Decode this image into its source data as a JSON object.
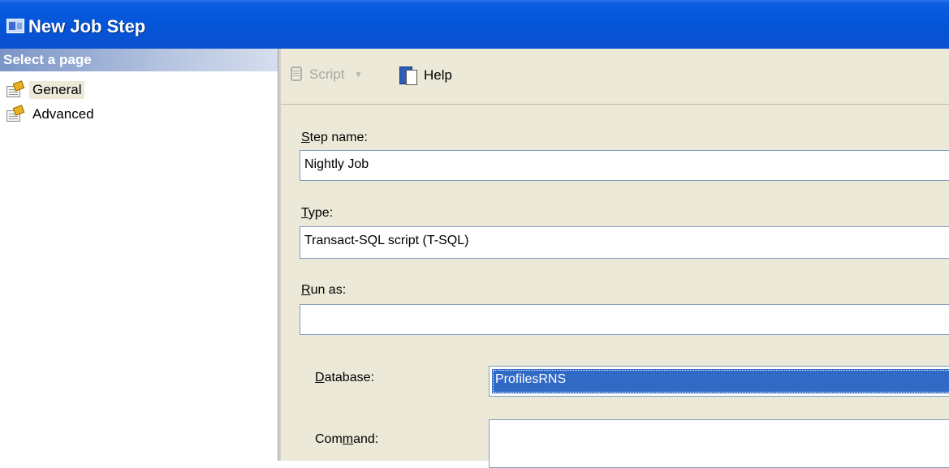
{
  "window": {
    "title": "New Job Step"
  },
  "left_pane": {
    "header": "Select a page",
    "items": [
      {
        "label": "General",
        "selected": true,
        "icon": "page-properties-icon"
      },
      {
        "label": "Advanced",
        "selected": false,
        "icon": "page-properties-icon"
      }
    ]
  },
  "toolbar": {
    "script_label": "Script",
    "help_label": "Help"
  },
  "form": {
    "step_name": {
      "label_accel": "S",
      "label_rest": "tep name:",
      "value": "Nightly Job"
    },
    "type": {
      "label_accel": "T",
      "label_rest": "ype:",
      "value": "Transact-SQL script (T-SQL)"
    },
    "run_as": {
      "label_accel": "R",
      "label_rest": "un as:",
      "value": ""
    },
    "database": {
      "label_accel": "D",
      "label_rest": "atabase:",
      "value": "ProfilesRNS"
    },
    "command": {
      "label_pre": "Com",
      "label_accel": "m",
      "label_rest": "and:",
      "value": ""
    }
  },
  "colors": {
    "titlebar": "#0455d8",
    "selection": "#316ac5",
    "panel": "#ece9d8"
  }
}
